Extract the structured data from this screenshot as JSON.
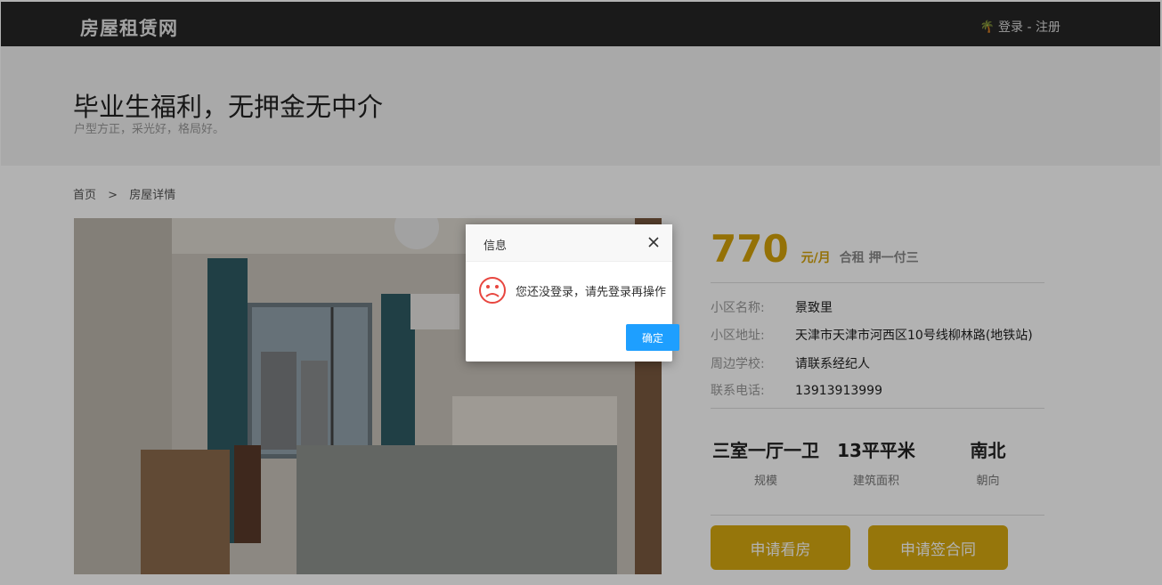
{
  "header": {
    "brand": "房屋租赁网",
    "auth_icon": "palm-tree-icon",
    "auth_text": "登录 - 注册"
  },
  "hero": {
    "title": "毕业生福利，无押金无中介",
    "subtitle": "户型方正，采光好，格局好。"
  },
  "breadcrumb": {
    "home": "首页",
    "separator": ">",
    "current": "房屋详情"
  },
  "listing": {
    "price": "770",
    "unit": "元/月",
    "rent_type": "合租 押一付三",
    "details": [
      {
        "label": "小区名称:",
        "value": "景致里"
      },
      {
        "label": "小区地址:",
        "value": "天津市天津市河西区10号线柳林路(地铁站)"
      },
      {
        "label": "周边学校:",
        "value": "请联系经纪人"
      },
      {
        "label": "联系电话:",
        "value": "13913913999"
      }
    ],
    "stats": [
      {
        "value": "三室一厅一卫",
        "label": "规模"
      },
      {
        "value": "13平平米",
        "label": "建筑面积"
      },
      {
        "value": "南北",
        "label": "朝向"
      }
    ],
    "actions": {
      "view": "申请看房",
      "sign": "申请签合同"
    }
  },
  "dialog": {
    "title": "信息",
    "message": "您还没登录，请先登录再操作",
    "confirm": "确定",
    "icon": "sad-face-icon",
    "close_icon": "close-icon"
  },
  "colors": {
    "accent": "#d7aa11",
    "dialog_button": "#1e9fff",
    "topbar": "#262626"
  }
}
